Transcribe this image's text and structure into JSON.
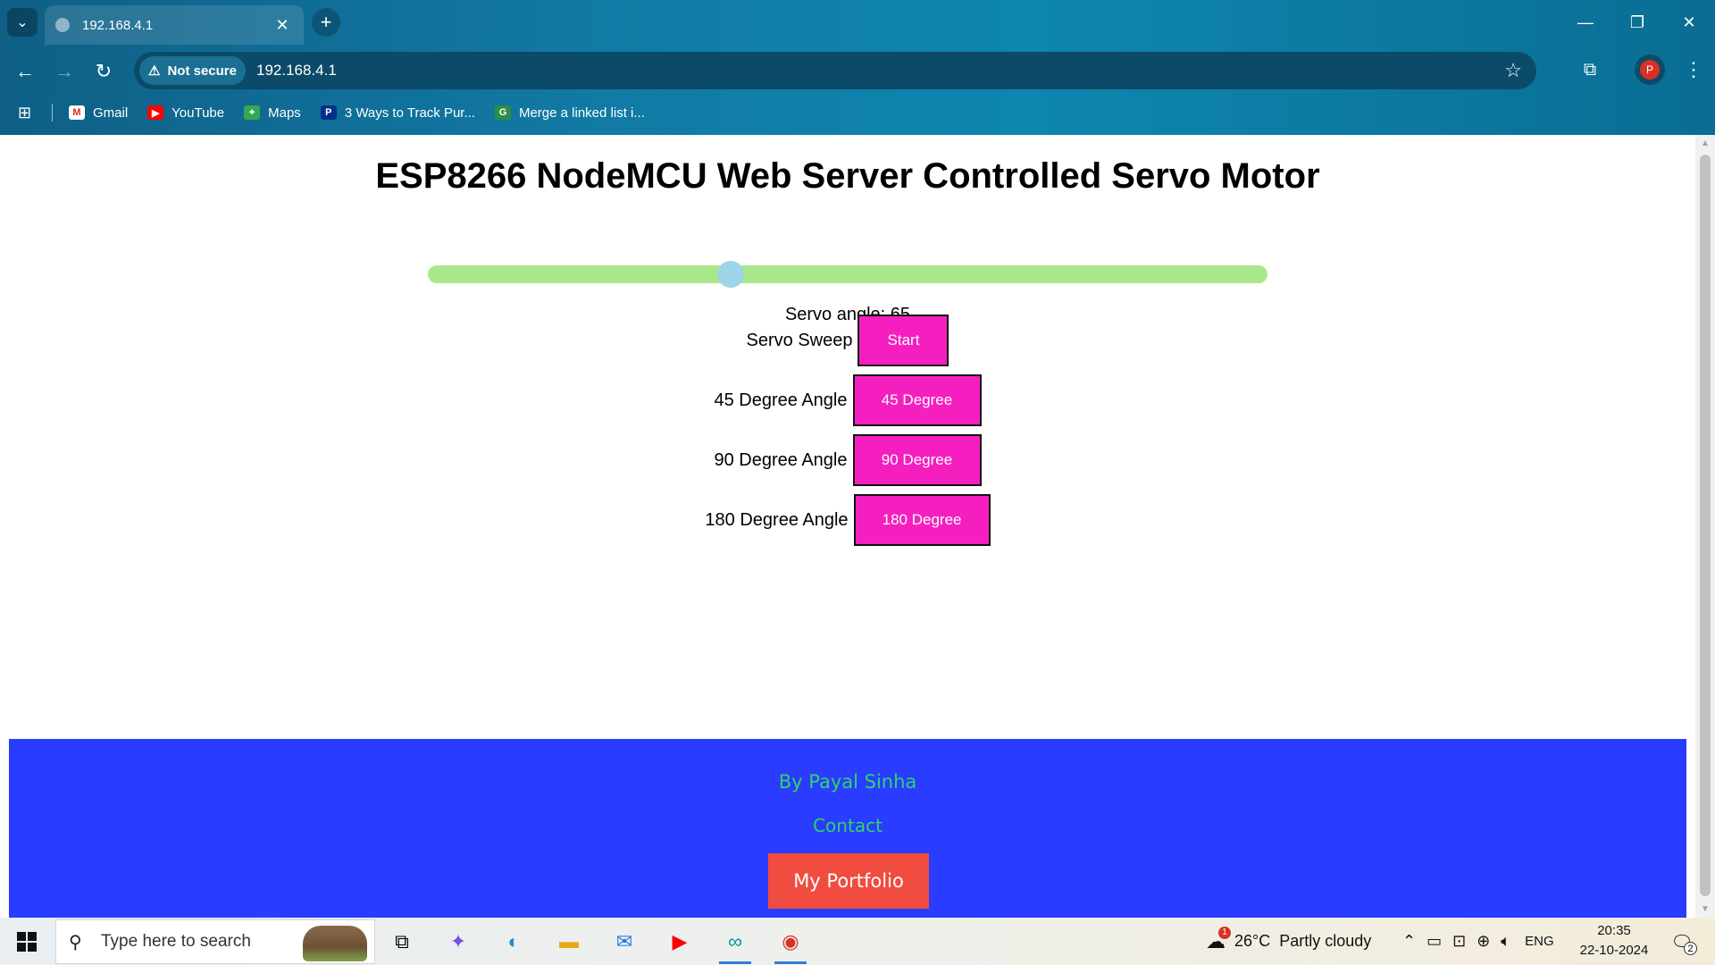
{
  "browser": {
    "tab_title": "192.168.4.1",
    "tab_close": "✕",
    "new_tab": "+",
    "window_controls": {
      "minimize": "—",
      "restore": "❐",
      "close": "✕"
    },
    "security_label": "Not secure",
    "url": "192.168.4.1",
    "profile_initial": "P",
    "bookmarks": [
      {
        "label": "Gmail",
        "icon": "gmail-icon",
        "color": "#d93025"
      },
      {
        "label": "YouTube",
        "icon": "youtube-icon",
        "color": "#ff0000"
      },
      {
        "label": "Maps",
        "icon": "maps-icon",
        "color": "#34a853"
      },
      {
        "label": "3 Ways to Track Pur...",
        "icon": "paypal-icon",
        "color": "#003087"
      },
      {
        "label": "Merge a linked list i...",
        "icon": "gfg-icon",
        "color": "#2f8d46"
      }
    ]
  },
  "page": {
    "title": "ESP8266 NodeMCU Web Server Controlled Servo Motor",
    "slider": {
      "value": 65,
      "min": 0,
      "max": 180,
      "track_color": "#a8e88a",
      "thumb_color": "#9dd4e8"
    },
    "angle_label": "Servo angle: ",
    "angle_value": "65",
    "controls": [
      {
        "label": "Servo Sweep",
        "button": "Start"
      },
      {
        "label": "45 Degree Angle",
        "button": "45 Degree"
      },
      {
        "label": "90 Degree Angle",
        "button": "90 Degree"
      },
      {
        "label": "180 Degree Angle",
        "button": "180 Degree"
      }
    ],
    "button_color": "#f51fc0"
  },
  "footer": {
    "by": "By Payal Sinha",
    "contact": "Contact",
    "portfolio": "My Portfolio",
    "background": "#2a3cff",
    "text_color": "#2dd56b",
    "portfolio_color": "#f04c3f"
  },
  "taskbar": {
    "search_placeholder": "Type here to search",
    "weather_temp": "26°C",
    "weather_desc": "Partly cloudy",
    "weather_badge": "1",
    "language": "ENG",
    "time": "20:35",
    "date": "22-10-2024",
    "notification_count": "2"
  }
}
